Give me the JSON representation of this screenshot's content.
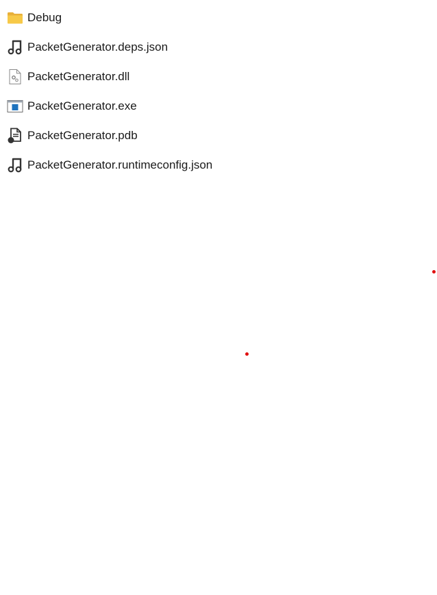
{
  "files": [
    {
      "name": "Debug",
      "icon": "folder-icon"
    },
    {
      "name": "PacketGenerator.deps.json",
      "icon": "json-file-icon"
    },
    {
      "name": "PacketGenerator.dll",
      "icon": "dll-file-icon"
    },
    {
      "name": "PacketGenerator.exe",
      "icon": "exe-file-icon"
    },
    {
      "name": "PacketGenerator.pdb",
      "icon": "pdb-file-icon"
    },
    {
      "name": "PacketGenerator.runtimeconfig.json",
      "icon": "json-file-icon"
    }
  ],
  "colors": {
    "folder": "#f7c948",
    "exe_accent": "#1e73be",
    "marker": "#e01010"
  }
}
